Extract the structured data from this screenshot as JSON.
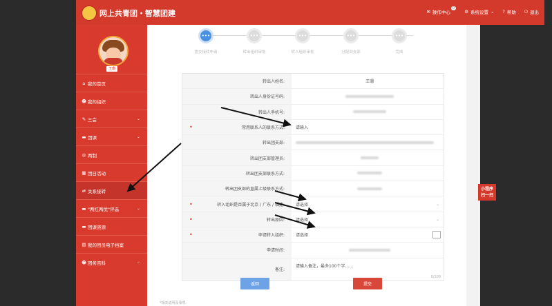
{
  "header": {
    "brand": "网上共青团・智慧团建",
    "message_label": "操作中心",
    "message_count": "0",
    "settings_label": "系统设置",
    "help_label": "帮助",
    "logout_label": "退出"
  },
  "user": {
    "name": "王珊"
  },
  "sidebar": {
    "items": [
      {
        "label": "我的首页",
        "icon": "home-icon"
      },
      {
        "label": "我的组织",
        "icon": "users-icon"
      },
      {
        "label": "三会",
        "icon": "edit-icon",
        "chevron": true
      },
      {
        "label": "团课",
        "icon": "folder-icon",
        "chevron": true
      },
      {
        "label": "两制",
        "icon": "target-icon"
      },
      {
        "label": "团日活动",
        "icon": "calendar-icon"
      },
      {
        "label": "关系接转",
        "icon": "transfer-icon"
      },
      {
        "label": "\"两红两优\"评选",
        "icon": "folder-icon",
        "chevron": true
      },
      {
        "label": "团课资源",
        "icon": "folder-icon"
      },
      {
        "label": "我的团员电子档案",
        "icon": "file-icon"
      },
      {
        "label": "团务百科",
        "icon": "users-icon",
        "chevron": true
      }
    ]
  },
  "steps": [
    {
      "label": "提交接转申请"
    },
    {
      "label": "转出组织审批"
    },
    {
      "label": "转入组织审批"
    },
    {
      "label": "分配到支部"
    },
    {
      "label": "完成"
    }
  ],
  "form": {
    "rows": [
      {
        "key": "转出人姓名:",
        "value": "王珊",
        "type": "text"
      },
      {
        "key": "转出人身份证号码:",
        "value": "",
        "type": "blur"
      },
      {
        "key": "转出人手机号:",
        "value": "",
        "type": "blur"
      },
      {
        "key": "常用联系人的联系方式:",
        "value": "",
        "placeholder": "请输入",
        "type": "input",
        "required": true
      },
      {
        "key": "转出团支部:",
        "value": "",
        "type": "blurwide"
      },
      {
        "key": "转出团支部管理员:",
        "value": "",
        "type": "blur"
      },
      {
        "key": "转出团支部联系方式:",
        "value": "",
        "type": "blur"
      },
      {
        "key": "转出团支部的直属上级联系方式:",
        "value": "",
        "type": "blur"
      },
      {
        "key": "转入组织是否属于北京 / 广东 / 福建:",
        "value": "",
        "placeholder": "请选择",
        "type": "select",
        "required": true
      },
      {
        "key": "转出原因:",
        "value": "",
        "placeholder": "请选择",
        "type": "select",
        "required": true
      },
      {
        "key": "申请转入组织:",
        "value": "",
        "placeholder": "请选择",
        "type": "picker",
        "required": true
      },
      {
        "key": "申请时间:",
        "value": "",
        "type": "blur"
      },
      {
        "key": "备注:",
        "value": "",
        "placeholder": "请输入备注，最多100个字……",
        "counter": "0/100",
        "type": "textarea"
      }
    ]
  },
  "buttons": {
    "back": "返回",
    "submit": "提交"
  },
  "bottom_note": "*相关说明及事项：",
  "mini_program": {
    "line1": "小程序",
    "line2": "扫一扫"
  }
}
